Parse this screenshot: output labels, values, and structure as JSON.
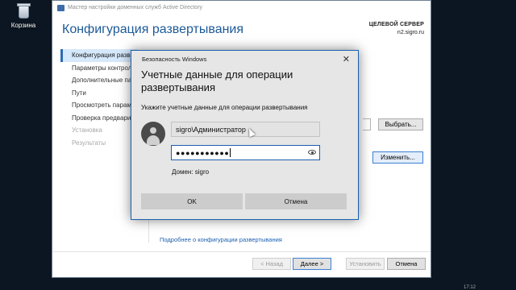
{
  "desktop": {
    "recycle_bin_label": "Корзина"
  },
  "wizard": {
    "window_title": "Мастер настройки доменных служб Active Directory",
    "page_heading": "Конфигурация развертывания",
    "server_caption": "ЦЕЛЕВОЙ СЕРВЕР",
    "server_name": "n2.sigro.ru",
    "nav": [
      {
        "label": "Конфигурация разв",
        "state": "active"
      },
      {
        "label": "Параметры контрол",
        "state": "normal"
      },
      {
        "label": "Дополнительные па",
        "state": "normal"
      },
      {
        "label": "Пути",
        "state": "normal"
      },
      {
        "label": "Просмотреть парам",
        "state": "normal"
      },
      {
        "label": "Проверка предвари",
        "state": "normal"
      },
      {
        "label": "Установка",
        "state": "disabled"
      },
      {
        "label": "Результаты",
        "state": "disabled"
      }
    ],
    "select_button": "Выбрать...",
    "change_button": "Изменить...",
    "more_link": "Подробнее о конфигурации развертывания",
    "footer": {
      "back": "< Назад",
      "next": "Далее >",
      "install": "Установить",
      "cancel": "Отмена"
    }
  },
  "dialog": {
    "title": "Безопасность Windows",
    "heading": "Учетные данные для операции развертывания",
    "subtitle": "Укажите учетные данные для операции развертывания",
    "username_value": "sigro\\Администратор",
    "password_mask": "●●●●●●●●●●●",
    "domain_label": "Домен: sigro",
    "ok": "OK",
    "cancel": "Отмена"
  },
  "taskbar": {
    "clock_partial": "17:12"
  }
}
